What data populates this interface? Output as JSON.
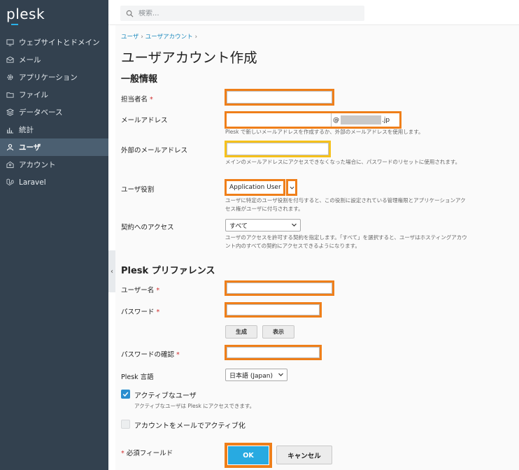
{
  "app": {
    "logo_text": "plesk"
  },
  "search": {
    "placeholder": "検索..."
  },
  "sidebar": {
    "items": [
      {
        "label": "ウェブサイトとドメイン",
        "icon": "monitor-icon"
      },
      {
        "label": "メール",
        "icon": "mail-icon"
      },
      {
        "label": "アプリケーション",
        "icon": "gear-icon"
      },
      {
        "label": "ファイル",
        "icon": "folder-icon"
      },
      {
        "label": "データベース",
        "icon": "layers-icon"
      },
      {
        "label": "統計",
        "icon": "bar-chart-icon"
      },
      {
        "label": "ユーザ",
        "icon": "user-icon",
        "active": true
      },
      {
        "label": "アカウント",
        "icon": "account-icon"
      },
      {
        "label": "Laravel",
        "icon": "laravel-icon"
      }
    ]
  },
  "breadcrumb": {
    "item1": "ユーザ",
    "item2": "ユーザアカウント",
    "sep": "›"
  },
  "page": {
    "title": "ユーザアカウント作成"
  },
  "general": {
    "section_title": "一般情報",
    "contact_name_label": "担当者名",
    "email_label": "メールアドレス",
    "email_at": "@",
    "email_tld": ".jp",
    "email_hint": "Plesk で新しいメールアドレスを作成するか、外部のメールアドレスを使用します。",
    "external_email_label": "外部のメールアドレス",
    "external_email_hint": "メインのメールアドレスにアクセスできなくなった場合に、パスワードのリセットに使用されます。",
    "role_label": "ユーザ役割",
    "role_value": "Application User",
    "role_hint": "ユーザに特定のユーザ役割を付与すると、この役割に設定されている管理権限とアプリケーションアクセス権がユーザに付与されます。",
    "subscription_label": "契約へのアクセス",
    "subscription_value": "すべて",
    "subscription_hint": "ユーザのアクセスを許可する契約を指定します。「すべて」を選択すると、ユーザはホスティングアカウント内のすべての契約にアクセスできるようになります。"
  },
  "prefs": {
    "section_title": "Plesk プリファレンス",
    "username_label": "ユーザー名",
    "password_label": "パスワード",
    "generate_button": "生成",
    "show_button": "表示",
    "confirm_label": "パスワードの確認",
    "language_label": "Plesk 言語",
    "language_value": "日本語 (Japan)",
    "active_user_label": "アクティブなユーザ",
    "active_user_hint": "アクティブなユーザは Plesk にアクセスできます。",
    "activate_by_mail_label": "アカウントをメールでアクティブ化"
  },
  "footer": {
    "required_note": "必須フィールド",
    "required_star": "*",
    "ok_button": "OK",
    "cancel_button": "キャンセル"
  },
  "colors": {
    "accent": "#28aae1",
    "highlight": "#ef7f1a",
    "sidebar_bg": "#33414f"
  }
}
